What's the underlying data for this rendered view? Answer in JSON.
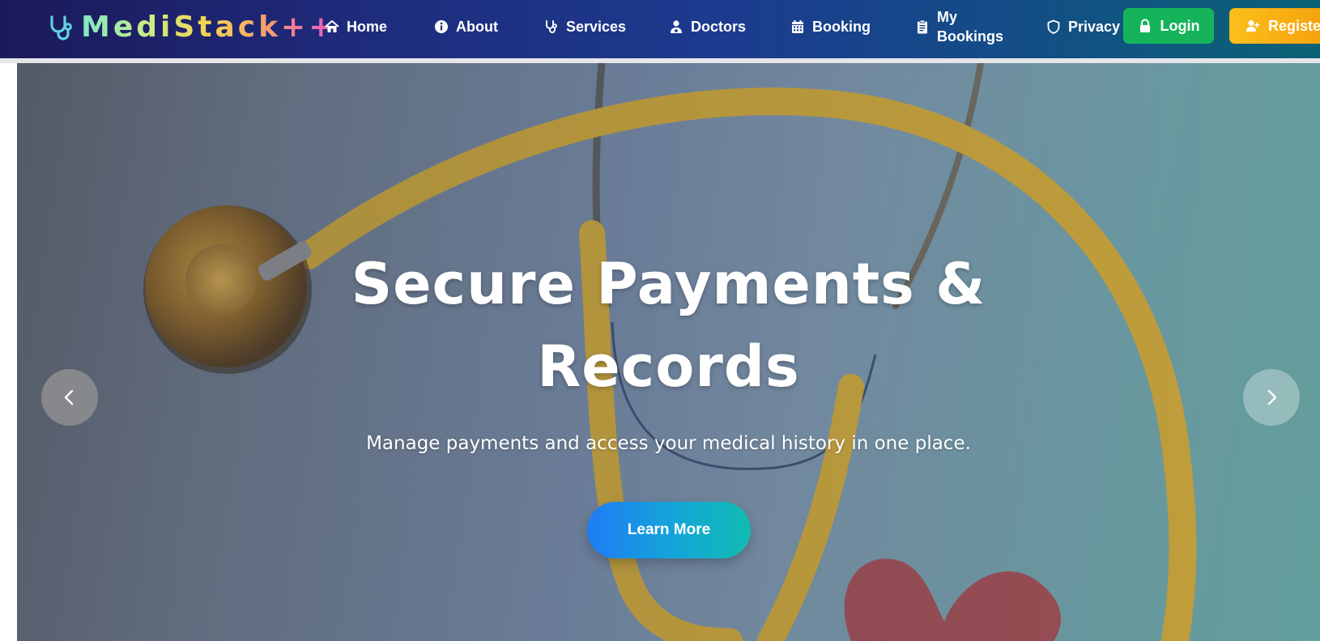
{
  "brand": {
    "name": "MediStack++"
  },
  "nav": {
    "items": [
      {
        "label": "Home",
        "icon": "home-icon"
      },
      {
        "label": "About",
        "icon": "info-circle-icon"
      },
      {
        "label": "Services",
        "icon": "stethoscope-icon"
      },
      {
        "label": "Doctors",
        "icon": "user-doctor-icon"
      },
      {
        "label": "Booking",
        "icon": "calendar-icon"
      },
      {
        "label_line1": "My",
        "label_line2": "Bookings",
        "icon": "clipboard-list-icon"
      },
      {
        "label": "Privacy",
        "icon": "shield-icon"
      }
    ],
    "login_label": "Login",
    "register_label": "Register"
  },
  "hero": {
    "title_line1": "Secure Payments &",
    "title_line2": "Records",
    "subtitle": "Manage payments and access your medical history in one place.",
    "cta_label": "Learn More"
  },
  "colors": {
    "login": "#16b45a",
    "register": "#fbbf1a",
    "cta_start": "#1f7cf5",
    "cta_end": "#0fbcb0",
    "nav_start": "#1c1a5a",
    "nav_end": "#0b6276"
  }
}
